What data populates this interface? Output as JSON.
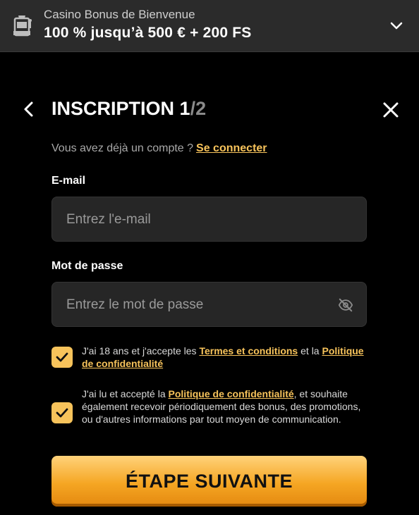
{
  "banner": {
    "subtitle": "Casino Bonus de Bienvenue",
    "offer": "100 % jusqu’à 500 € + 200 FS",
    "icon": "slot-machine-icon"
  },
  "header": {
    "title": "INSCRIPTION",
    "step_current": "1",
    "step_separator": "/",
    "step_total": "2"
  },
  "account": {
    "prompt": "Vous avez déjà un compte ?",
    "login_link": "Se connecter"
  },
  "email": {
    "label": "E-mail",
    "placeholder": "Entrez l'e-mail",
    "value": ""
  },
  "password": {
    "label": "Mot de passe",
    "placeholder": "Entrez le mot de passe",
    "value": "",
    "visibility_icon": "eye-off-icon"
  },
  "consents": [
    {
      "checked": true,
      "text_before": "J'ai 18 ans et j'accepte les ",
      "link1": "Termes et conditions",
      "text_middle": " et la ",
      "link2": "Politique de confidentialité",
      "text_after": ""
    },
    {
      "checked": true,
      "text_before": "J'ai lu et accepté la ",
      "link1": "Politique de confidentialité",
      "text_after": ", et souhaite également recevoir périodiquement des bonus, des promotions, ou d'autres informations par tout moyen de communication."
    }
  ],
  "next_button": "ÉTAPE SUIVANTE",
  "colors": {
    "accent": "#f7c35b",
    "background": "#000000",
    "banner": "#2b2b2b",
    "field": "#262626"
  }
}
